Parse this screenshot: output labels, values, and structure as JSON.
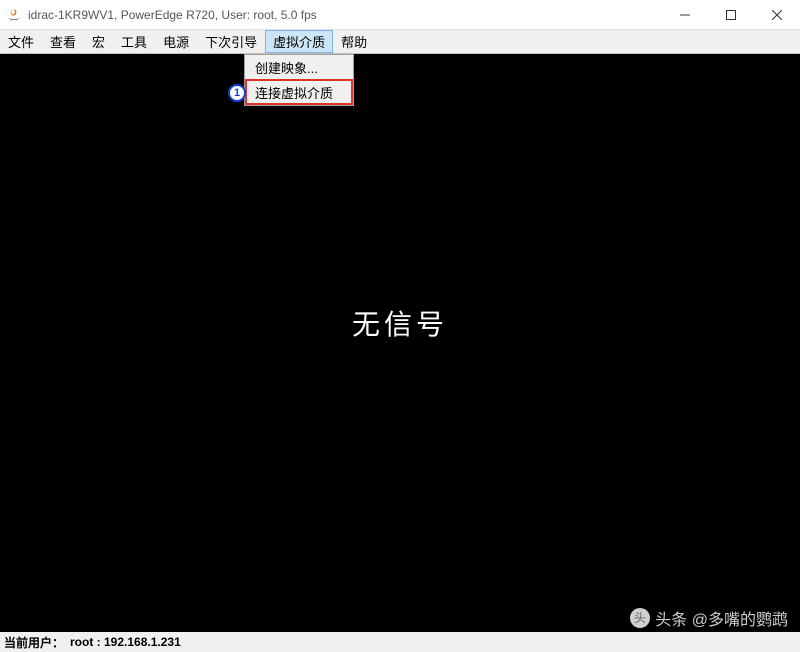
{
  "titlebar": {
    "title": "idrac-1KR9WV1, PowerEdge R720, User: root, 5.0 fps"
  },
  "menubar": {
    "items": [
      "文件",
      "查看",
      "宏",
      "工具",
      "电源",
      "下次引导",
      "虚拟介质",
      "帮助"
    ],
    "open_index": 6
  },
  "dropdown": {
    "items": [
      {
        "label": "创建映象...",
        "highlighted": false
      },
      {
        "label": "连接虚拟介质",
        "highlighted": true
      }
    ]
  },
  "annotation": {
    "number": "1"
  },
  "console": {
    "message": "无信号"
  },
  "statusbar": {
    "label": "当前用户：",
    "value": "root : 192.168.1.231"
  },
  "watermark": {
    "text": "头条 @多嘴的鹦鹉"
  }
}
